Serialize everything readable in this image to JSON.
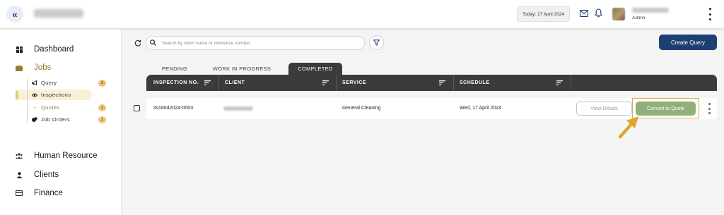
{
  "header": {
    "collapse_glyph": "«",
    "date_label": "Today: 17 April 2024",
    "user_role": "Admin",
    "icons": [
      "chevron-double-left-icon",
      "mail-icon",
      "bell-icon",
      "kebab-icon"
    ]
  },
  "sidebar": {
    "main_items": [
      {
        "label": "Dashboard",
        "icon": "grid-icon"
      },
      {
        "label": "Jobs",
        "icon": "briefcase-icon"
      },
      {
        "label": "Human Resource",
        "icon": "people-icon"
      },
      {
        "label": "Clients",
        "icon": "person-icon"
      },
      {
        "label": "Finance",
        "icon": "card-icon"
      }
    ],
    "job_items": [
      {
        "label": "Query",
        "badge": "2",
        "icon": "megaphone-icon"
      },
      {
        "label": "Inspections",
        "badge": "",
        "icon": "eye-icon"
      },
      {
        "label": "Quotes",
        "badge": "1",
        "icon": "arrow-right-icon"
      },
      {
        "label": "Job Orders",
        "badge": "1",
        "icon": "stack-icon"
      }
    ],
    "active_item": "Inspections"
  },
  "toolbar": {
    "search_placeholder": "Search by client name or reference number",
    "create_label": "Create Query"
  },
  "tabs": [
    {
      "label": "PENDING"
    },
    {
      "label": "WORK IN PROGRESS"
    },
    {
      "label": "COMPLETED",
      "active": true
    }
  ],
  "table": {
    "columns": [
      "INSPECTION NO.",
      "CLIENT",
      "SERVICE",
      "SCHEDULE"
    ],
    "rows": [
      {
        "inspection_no": "IN16042024-0003",
        "service": "General Cleaning",
        "schedule": "Wed, 17 April 2024",
        "view_label": "View Details",
        "convert_label": "Convert to Quote"
      }
    ]
  },
  "colors": {
    "primary": "#1e3f72",
    "table_header": "#3b3b3b",
    "accent_yellow": "#e8c879",
    "convert_green": "#8fb07a",
    "highlight_border": "#e0a93a"
  }
}
